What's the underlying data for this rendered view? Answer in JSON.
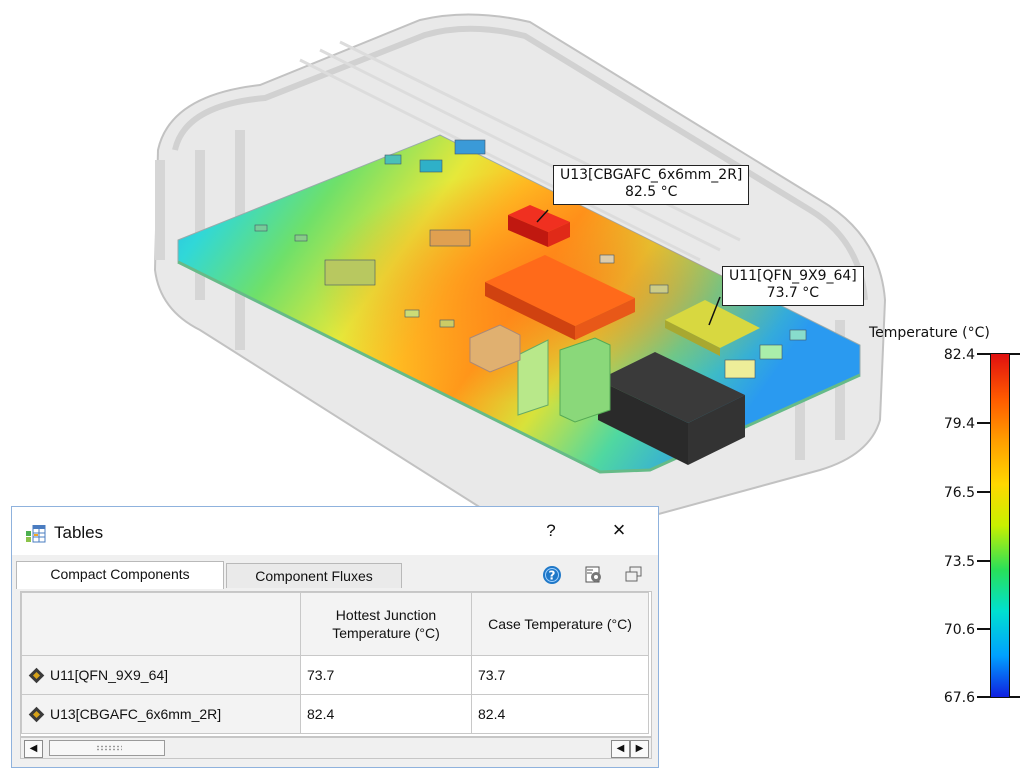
{
  "legend": {
    "title": "Temperature (°C)",
    "ticks": [
      "82.4",
      "79.4",
      "76.5",
      "73.5",
      "70.6",
      "67.6"
    ],
    "colors": [
      "#e01010",
      "#ff9c00",
      "#ffd800",
      "#28e05a",
      "#00a0ff",
      "#1020e0"
    ]
  },
  "callouts": {
    "u13": {
      "name": "U13[CBGAFC_6x6mm_2R]",
      "temp": "82.5 °C"
    },
    "u11": {
      "name": "U11[QFN_9X9_64]",
      "temp": "73.7 °C"
    }
  },
  "dialog": {
    "title": "Tables",
    "help": "?",
    "close": "×",
    "tabs": [
      "Compact Components",
      "Component Fluxes"
    ],
    "columns": [
      "Hottest Junction Temperature (°C)",
      "Case Temperature (°C)"
    ],
    "rows": [
      {
        "name": "U11[QFN_9X9_64]",
        "hottest": "73.7",
        "case": "73.7"
      },
      {
        "name": "U13[CBGAFC_6x6mm_2R]",
        "hottest": "82.4",
        "case": "82.4"
      }
    ],
    "icons": [
      "help-circle-icon",
      "settings-export-icon",
      "restore-window-icon"
    ]
  }
}
